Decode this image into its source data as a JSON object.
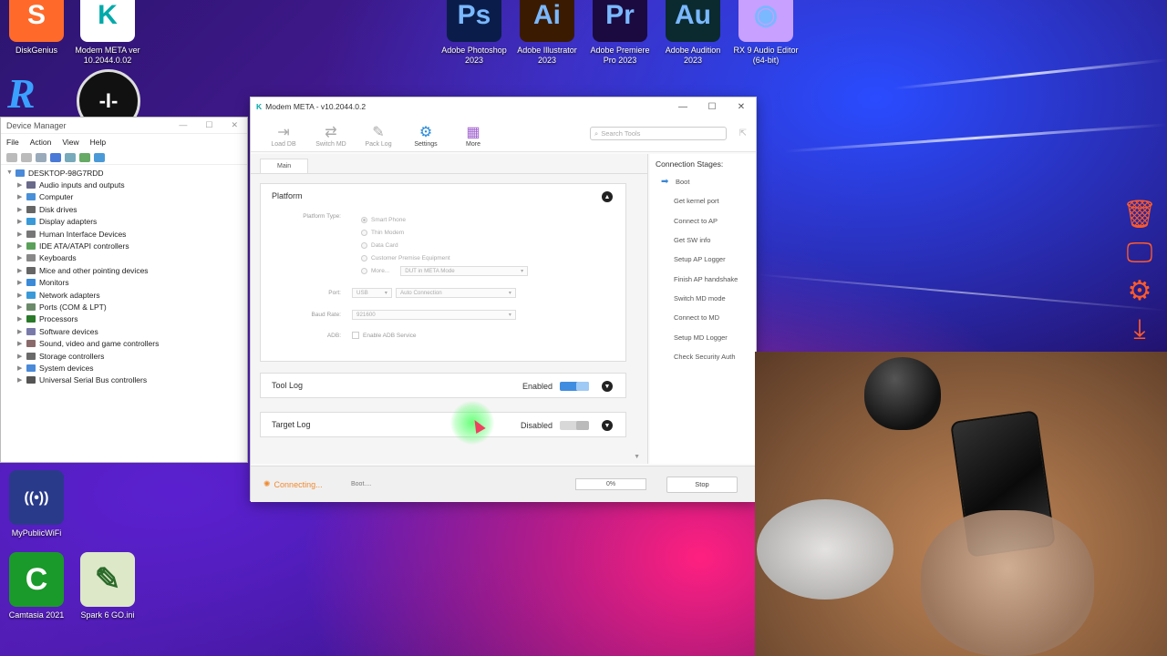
{
  "desktop": {
    "top_icons": [
      {
        "label": "DiskGenius",
        "glyph": "S",
        "color": "#ff6a2a"
      },
      {
        "label": "Modem META ver 10.2044.0.02",
        "glyph": "K",
        "color": "#ffffff"
      },
      {
        "label": "Adobe Photoshop 2023",
        "glyph": "Ps",
        "color": "#0a1d4a"
      },
      {
        "label": "Adobe Illustrator 2023",
        "glyph": "Ai",
        "color": "#3a1a00"
      },
      {
        "label": "Adobe Premiere Pro 2023",
        "glyph": "Pr",
        "color": "#1a0a40"
      },
      {
        "label": "Adobe Audition 2023",
        "glyph": "Au",
        "color": "#0a2a30"
      },
      {
        "label": "RX 9 Audio Editor (64-bit)",
        "glyph": "◉",
        "color": "#c8a0ff"
      }
    ],
    "bottom_icons": [
      {
        "label": "MyPublicWiFi",
        "glyph": "((•))"
      },
      {
        "label": "Camtasia 2021",
        "glyph": "C"
      },
      {
        "label": "Spark 6 GO.ini",
        "glyph": "✎"
      }
    ]
  },
  "device_manager": {
    "title": "Device Manager",
    "menu": [
      "File",
      "Action",
      "View",
      "Help"
    ],
    "root": "DESKTOP-98G7RDD",
    "items": [
      {
        "label": "Audio inputs and outputs",
        "color": "#6a6a8a"
      },
      {
        "label": "Computer",
        "color": "#4a90d8"
      },
      {
        "label": "Disk drives",
        "color": "#666"
      },
      {
        "label": "Display adapters",
        "color": "#3a9ad8"
      },
      {
        "label": "Human Interface Devices",
        "color": "#777"
      },
      {
        "label": "IDE ATA/ATAPI controllers",
        "color": "#5aa05a"
      },
      {
        "label": "Keyboards",
        "color": "#888"
      },
      {
        "label": "Mice and other pointing devices",
        "color": "#666"
      },
      {
        "label": "Monitors",
        "color": "#3a8ad8"
      },
      {
        "label": "Network adapters",
        "color": "#3a9ad8"
      },
      {
        "label": "Ports (COM & LPT)",
        "color": "#6a8a6a"
      },
      {
        "label": "Processors",
        "color": "#2a7a2a"
      },
      {
        "label": "Software devices",
        "color": "#7a7aaa"
      },
      {
        "label": "Sound, video and game controllers",
        "color": "#8a6a6a"
      },
      {
        "label": "Storage controllers",
        "color": "#6a6a6a"
      },
      {
        "label": "System devices",
        "color": "#4a8ad8"
      },
      {
        "label": "Universal Serial Bus controllers",
        "color": "#555"
      }
    ]
  },
  "modem_meta": {
    "title": "Modem META - v10.2044.0.2",
    "toolbar": [
      {
        "label": "Load DB",
        "icon": "load-db-icon",
        "glyph": "⇥"
      },
      {
        "label": "Switch MD",
        "icon": "switch-icon",
        "glyph": "⇄"
      },
      {
        "label": "Pack Log",
        "icon": "paperclip-icon",
        "glyph": "✎"
      },
      {
        "label": "Settings",
        "icon": "gear-icon",
        "glyph": "⚙"
      },
      {
        "label": "More",
        "icon": "grid-icon",
        "glyph": "▦"
      }
    ],
    "search_placeholder": "Search Tools",
    "tab_main": "Main",
    "platform": {
      "title": "Platform",
      "platform_type_label": "Platform Type:",
      "options": [
        "Smart Phone",
        "Thin Modem",
        "Data Card",
        "Customer Premise Equipment",
        "More..."
      ],
      "selected_option": "Smart Phone",
      "more_select_value": "DUT in META Mode",
      "port_label": "Port:",
      "port_value": "USB",
      "port_mode": "Auto Connection",
      "baud_label": "Baud Rate:",
      "baud_value": "921600",
      "adb_label": "ADB:",
      "adb_checkbox": "Enable ADB Service"
    },
    "tool_log": {
      "title": "Tool Log",
      "state": "Enabled",
      "enabled": true
    },
    "target_log": {
      "title": "Target Log",
      "state": "Disabled",
      "enabled": false
    },
    "stages_header": "Connection Stages:",
    "stages": [
      "Boot",
      "Get kernel port",
      "Connect to AP",
      "Get SW info",
      "Setup AP Logger",
      "Finish AP handshake",
      "Switch MD mode",
      "Connect to MD",
      "Setup MD Logger",
      "Check Security Auth"
    ],
    "current_stage": "Boot",
    "status": {
      "connecting": "Connecting...",
      "stage_text": "Boot....",
      "progress": "0%",
      "progress_value": 0,
      "stop_label": "Stop"
    }
  }
}
